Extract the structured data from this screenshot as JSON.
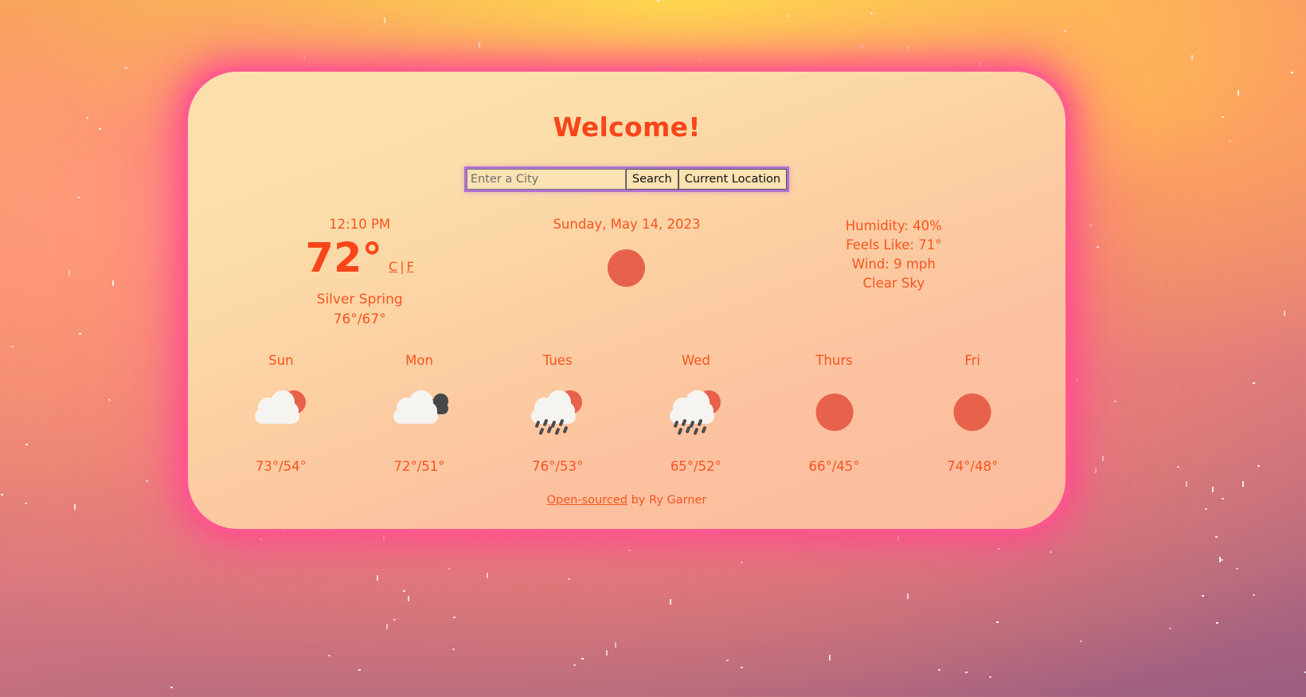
{
  "app": {
    "title": "Welcome!"
  },
  "search": {
    "placeholder": "Enter a City",
    "value": "",
    "search_label": "Search",
    "current_location_label": "Current Location"
  },
  "current": {
    "time": "12:10 PM",
    "temperature": "72°",
    "unit_celsius": "C",
    "unit_separator": "|",
    "unit_fahrenheit": "F",
    "city": "Silver Spring",
    "high_low": "76°/67°",
    "date": "Sunday, May 14, 2023",
    "icon": "sun-icon",
    "humidity": "Humidity: 40%",
    "feels_like": "Feels Like: 71°",
    "wind": "Wind: 9 mph",
    "description": "Clear Sky"
  },
  "forecast": [
    {
      "day": "Sun",
      "icon": "sun-behind-cloud-icon",
      "temp": "73°/54°"
    },
    {
      "day": "Mon",
      "icon": "cloudy-icon",
      "temp": "72°/51°"
    },
    {
      "day": "Tues",
      "icon": "sun-cloud-rain-icon",
      "temp": "76°/53°"
    },
    {
      "day": "Wed",
      "icon": "sun-cloud-rain-icon",
      "temp": "65°/52°"
    },
    {
      "day": "Thurs",
      "icon": "sun-icon",
      "temp": "66°/45°"
    },
    {
      "day": "Fri",
      "icon": "sun-icon",
      "temp": "74°/48°"
    }
  ],
  "footer": {
    "link_label": "Open-sourced",
    "credit": " by Ry Garner"
  },
  "colors": {
    "accent": "#f8451a",
    "text": "#f8541f",
    "sun": "#e8614a",
    "cloud": "#f6f4f1",
    "dark_cloud": "#474747",
    "glow": "#ff4a91",
    "input_border": "#b06fd0"
  }
}
